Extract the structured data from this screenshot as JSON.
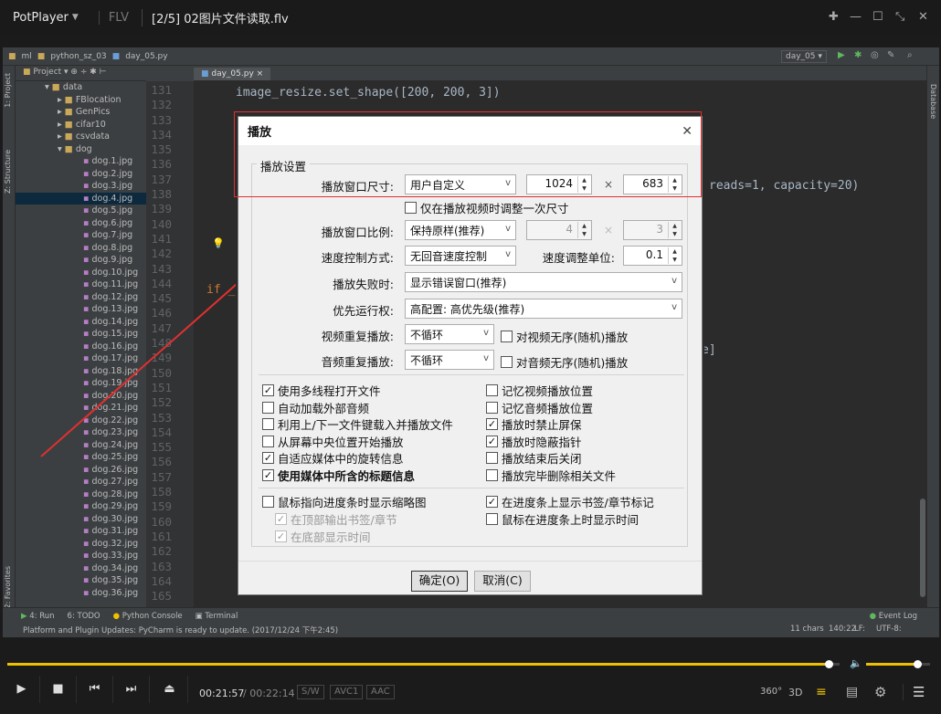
{
  "titlebar": {
    "app": "PotPlayer",
    "format": "FLV",
    "file": "[2/5] 02图片文件读取.flv"
  },
  "ide": {
    "nav": [
      "ml",
      "python_sz_03",
      "day_05.py"
    ],
    "run_config": "day_05",
    "project_label": "Project",
    "editor_tab": "day_05.py",
    "tree": [
      "data",
      "FBlocation",
      "GenPics",
      "cifar10",
      "csvdata",
      "dog",
      "dog.1.jpg",
      "dog.2.jpg",
      "dog.3.jpg",
      "dog.4.jpg",
      "dog.5.jpg",
      "dog.6.jpg",
      "dog.7.jpg",
      "dog.8.jpg",
      "dog.9.jpg",
      "dog.10.jpg",
      "dog.11.jpg",
      "dog.12.jpg",
      "dog.13.jpg",
      "dog.14.jpg",
      "dog.15.jpg",
      "dog.16.jpg",
      "dog.17.jpg",
      "dog.18.jpg",
      "dog.19.jpg",
      "dog.20.jpg",
      "dog.21.jpg",
      "dog.22.jpg",
      "dog.23.jpg",
      "dog.24.jpg",
      "dog.25.jpg",
      "dog.26.jpg",
      "dog.27.jpg",
      "dog.28.jpg",
      "dog.29.jpg",
      "dog.30.jpg",
      "dog.31.jpg",
      "dog.32.jpg",
      "dog.33.jpg",
      "dog.34.jpg",
      "dog.35.jpg",
      "dog.36.jpg"
    ],
    "line_numbers": [
      "131",
      "132",
      "133",
      "134",
      "135",
      "136",
      "137",
      "138",
      "139",
      "140",
      "141",
      "142",
      "143",
      "144",
      "145",
      "146",
      "147",
      "148",
      "149",
      "150",
      "151",
      "152",
      "153",
      "154",
      "155",
      "156",
      "157",
      "158",
      "159",
      "160",
      "161",
      "162",
      "163",
      "164",
      "165"
    ],
    "code_line_131": "image_resize.set_shape([200, 200, 3])",
    "code_fragment_right": "reads=1, capacity=20)",
    "code_if": "if _",
    "code_bracket": "e]",
    "side_left": [
      "1: Project",
      "Z: Structure",
      "2: Favorites"
    ],
    "side_right": "Database",
    "bottom_tabs": [
      "4: Run",
      "6: TODO",
      "Python Console",
      "Terminal"
    ],
    "event_log": "Event Log",
    "status_text": "Platform and Plugin Updates: PyCharm is ready to update. (2017/12/24 下午2:45)",
    "status_right": [
      "11 chars",
      "140:22",
      "LF:",
      "UTF-8:"
    ]
  },
  "dialog": {
    "title": "播放",
    "group_title": "播放设置",
    "window_size_label": "播放窗口尺寸:",
    "window_size_value": "用户自定义",
    "width": "1024",
    "height": "683",
    "times": "×",
    "resize_once": "仅在播放视频时调整一次尺寸",
    "ratio_label": "播放窗口比例:",
    "ratio_value": "保持原样(推荐)",
    "ratio_w": "4",
    "ratio_h": "3",
    "speed_mode_label": "速度控制方式:",
    "speed_mode_value": "无回音速度控制",
    "speed_unit_label": "速度调整单位:",
    "speed_unit_value": "0.1",
    "fail_label": "播放失败时:",
    "fail_value": "显示错误窗口(推荐)",
    "priority_label": "优先运行权:",
    "priority_value": "高配置: 高优先级(推荐)",
    "video_repeat_label": "视频重复播放:",
    "video_repeat_value": "不循环",
    "video_random": "对视频无序(随机)播放",
    "audio_repeat_label": "音频重复播放:",
    "audio_repeat_value": "不循环",
    "audio_random": "对音频无序(随机)播放",
    "left_checks": [
      {
        "label": "使用多线程打开文件",
        "checked": true
      },
      {
        "label": "自动加载外部音频",
        "checked": false
      },
      {
        "label": "利用上/下一文件键载入并播放文件",
        "checked": false
      },
      {
        "label": "从屏幕中央位置开始播放",
        "checked": false
      },
      {
        "label": "自适应媒体中的旋转信息",
        "checked": true
      },
      {
        "label": "使用媒体中所含的标题信息",
        "checked": true
      }
    ],
    "right_checks": [
      {
        "label": "记忆视频播放位置",
        "checked": false
      },
      {
        "label": "记忆音频播放位置",
        "checked": false
      },
      {
        "label": "播放时禁止屏保",
        "checked": true
      },
      {
        "label": "播放时隐蔽指针",
        "checked": true
      },
      {
        "label": "播放结束后关闭",
        "checked": false
      },
      {
        "label": "播放完毕删除相关文件",
        "checked": false
      }
    ],
    "thumb_preview": "鼠标指向进度条时显示缩略图",
    "top_bookmark": "在顶部输出书签/章节",
    "bottom_time": "在底部显示时间",
    "bookmark_marks": "在进度条上显示书签/章节标记",
    "hover_time": "鼠标在进度条上时显示时间",
    "ok": "确定(O)",
    "cancel": "取消(C)"
  },
  "player": {
    "current_time": "00:21:57",
    "total_time": "/ 00:22:14",
    "tags": [
      "S/W",
      "AVC1",
      "AAC"
    ],
    "progress": 0.987,
    "volume": 0.8,
    "right_icons": [
      "360°",
      "3D"
    ],
    "accent": "#f0c000"
  },
  "annotation": {
    "color": "#e03030"
  }
}
